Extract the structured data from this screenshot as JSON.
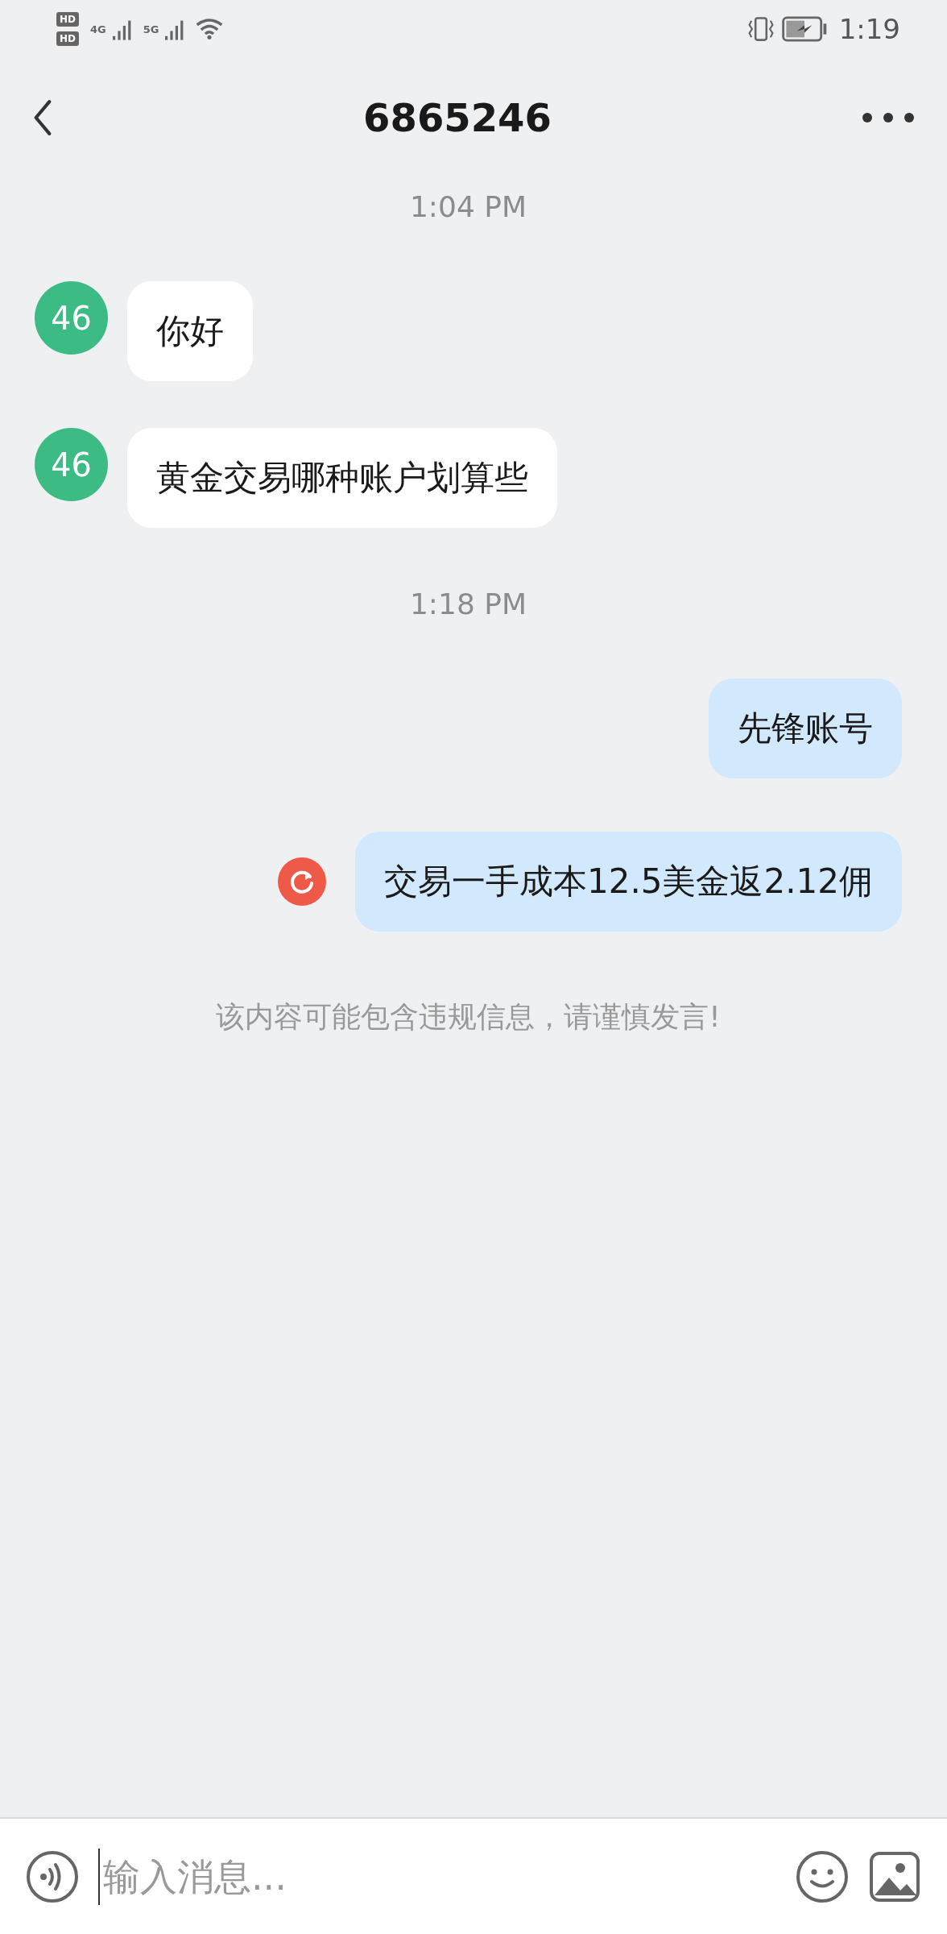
{
  "status_bar": {
    "sim_labels": [
      "HD",
      "HD"
    ],
    "networks": [
      "4G",
      "5G"
    ],
    "time": "1:19"
  },
  "header": {
    "title": "6865246"
  },
  "messages": [
    {
      "kind": "time",
      "text": "1:04 PM"
    },
    {
      "kind": "incoming",
      "avatar": "46",
      "text": "你好"
    },
    {
      "kind": "incoming",
      "avatar": "46",
      "text": "黄金交易哪种账户划算些"
    },
    {
      "kind": "time",
      "text": "1:18 PM"
    },
    {
      "kind": "outgoing",
      "text": "先锋账号",
      "failed": false
    },
    {
      "kind": "outgoing",
      "text": "交易一手成本12.5美金返2.12佣",
      "failed": true
    },
    {
      "kind": "notice",
      "text": "该内容可能包含违规信息，请谨慎发言!"
    }
  ],
  "input_bar": {
    "placeholder": "输入消息..."
  }
}
